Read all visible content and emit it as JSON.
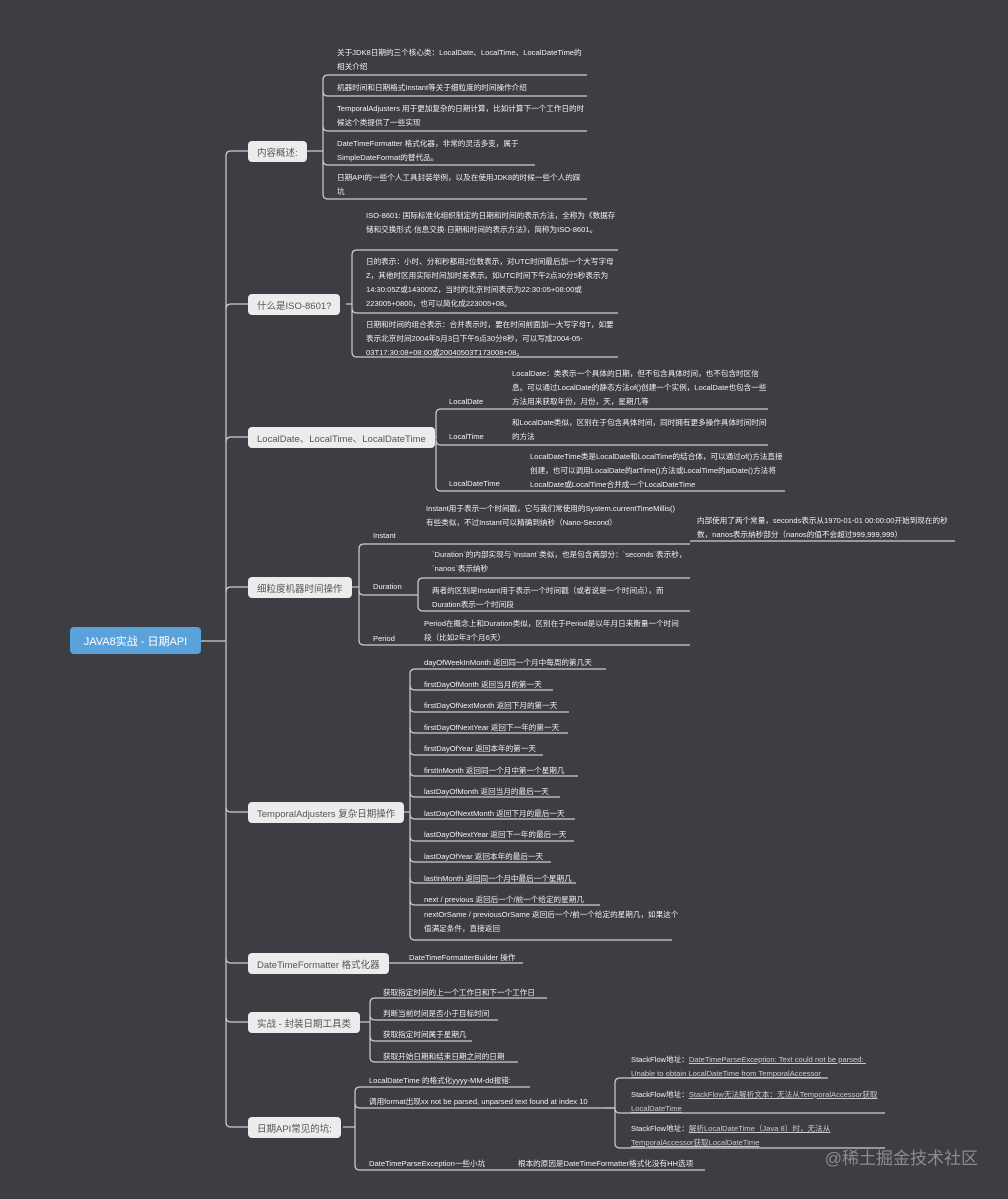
{
  "root": {
    "label": "JAVA8实战 - 日期API",
    "color": "#5aa2dc"
  },
  "topics": [
    {
      "id": "overview",
      "label": "内容概述:",
      "children": [
        "关于JDK8日期的三个核心类：LocalDate、LocalTime、LocalDateTime的相关介绍",
        "机器时间和日期格式Instant等关于细粒度的时间操作介绍",
        "TemporalAdjusters 用于更加复杂的日期计算，比如计算下一个工作日的时候这个类提供了一些实现",
        "DateTimeFormatter 格式化器，非常的灵活多变，属于SimpleDateFormat的替代品。",
        "日期API的一些个人工具封装举例，以及在使用JDK8的时候一些个人的踩坑"
      ]
    },
    {
      "id": "iso",
      "label": "什么是ISO-8601?",
      "children": [
        "ISO-8601: 国际标准化组织制定的日期和时间的表示方法，全称为《数据存储和交换形式·信息交换·日期和时间的表示方法》，简称为ISO-8601。",
        "日的表示：小时、分和秒都用2位数表示，对UTC时间最后加一个大写字母Z，其他时区用实际时间加时差表示。如UTC时间下午2点30分5秒表示为14:30:05Z或143005Z，当时的北京时间表示为22:30:05+08:00或223005+0800，也可以简化成223005+08。",
        "日期和时间的组合表示：合并表示时，要在时间前面加一大写字母T，如要表示北京时间2004年5月3日下午5点30分8秒，可以写成2004-05-03T17:30:08+08:00或20040503T173008+08。"
      ]
    },
    {
      "id": "localclasses",
      "label": "LocalDate、LocalTime、LocalDateTime",
      "children": [
        {
          "label": "LocalDate",
          "desc": "LocalDate：类表示一个具体的日期，但不包含具体时间，也不包含时区信息。可以通过LocalDate的静态方法of()创建一个实例，LocalDate也包含一些方法用来获取年份，月份，天，星期几等"
        },
        {
          "label": "LocalTime",
          "desc": "和LocalDate类似，区别在于包含具体时间，同时拥有更多操作具体时间时间的方法"
        },
        {
          "label": "LocalDateTime",
          "desc": "LocalDateTime类是LocalDate和LocalTime的结合体，可以通过of()方法直接创建，也可以调用LocalDate的atTime()方法或LocalTime的atDate()方法将LocalDate或LocalTime合并成一个LocalDateTime"
        }
      ]
    },
    {
      "id": "machine",
      "label": "细粒度机器时间操作",
      "children": [
        {
          "label": "Instant",
          "desc": "Instant用于表示一个时间戳，它与我们常使用的System.currentTimeMillis()有些类似，不过Instant可以精确到纳秒（Nano-Second）",
          "sub": "内部使用了两个常量，seconds表示从1970-01-01 00:00:00开始到现在的秒数，nanos表示纳秒部分（nanos的值不会超过999,999,999）"
        },
        {
          "label": "Duration",
          "desc": [
            "`Duration`的内部实现与`Instant`类似，也是包含两部分：`seconds`表示秒，`nanos`表示纳秒",
            "两者的区别是Instant用于表示一个时间戳（或者说是一个时间点），而Duration表示一个时间段"
          ]
        },
        {
          "label": "Period",
          "desc": "Period在概念上和Duration类似，区别在于Period是以年月日来衡量一个时间段（比如2年3个月6天）"
        }
      ]
    },
    {
      "id": "adjusters",
      "label": "TemporalAdjusters 复杂日期操作",
      "children": [
        "dayOfWeekInMonth 返回同一个月中每周的第几天",
        "firstDayOfMonth 返回当月的第一天",
        "firstDayOfNextMonth 返回下月的第一天",
        "firstDayOfNextYear 返回下一年的第一天",
        "firstDayOfYear 返回本年的第一天",
        "firstInMonth 返回同一个月中第一个星期几",
        "lastDayOfMonth 返回当月的最后一天",
        "lastDayOfNextMonth 返回下月的最后一天",
        "lastDayOfNextYear 返回下一年的最后一天",
        "lastDayOfYear 返回本年的最后一天",
        "lastInMonth 返回同一个月中最后一个星期几",
        "next / previous 返回后一个/前一个给定的星期几",
        "nextOrSame / previousOrSame 返回后一个/前一个给定的星期几，如果这个值满足条件，直接返回"
      ]
    },
    {
      "id": "formatter",
      "label": "DateTimeFormatter 格式化器",
      "children": [
        "DateTimeFormatterBuilder 操作"
      ]
    },
    {
      "id": "practice",
      "label": "实战 - 封装日期工具类",
      "children": [
        "获取指定时间的上一个工作日和下一个工作日",
        "判断当前时间是否小于目标时间",
        "获取指定时间属于星期几",
        "获取开始日期和结束日期之间的日期"
      ]
    },
    {
      "id": "pitfalls",
      "label": "日期API常见的坑:",
      "children": [
        "LocalDateTime 的格式化yyyy-MM-dd报错:",
        "调用format出现xx not be parsed, unparsed text found at index 10",
        "DateTimeParseException一些小坑"
      ],
      "cause": "根本的原因是DateTimeFormatter格式化没有HH选项",
      "stackflow": [
        {
          "prefix": "StackFlow地址：",
          "link": "DateTimeParseException: Text could not be parsed: Unable to obtain LocalDateTime from TemporalAccessor"
        },
        {
          "prefix": "StackFlow地址：",
          "link": "StackFlow无法解析文本：无法从TemporalAccessor获取LocalDateTime"
        },
        {
          "prefix": "StackFlow地址：",
          "link": "解析LocalDateTime（Java 8）时，无法从TemporalAccessor获取LocalDateTime"
        }
      ]
    }
  ],
  "watermark": "@稀土掘金技术社区",
  "colors": {
    "background": "#3d3e43",
    "line": "#cfcfcf",
    "topic_bg": "#ececec",
    "text": "#f2f2f2"
  }
}
